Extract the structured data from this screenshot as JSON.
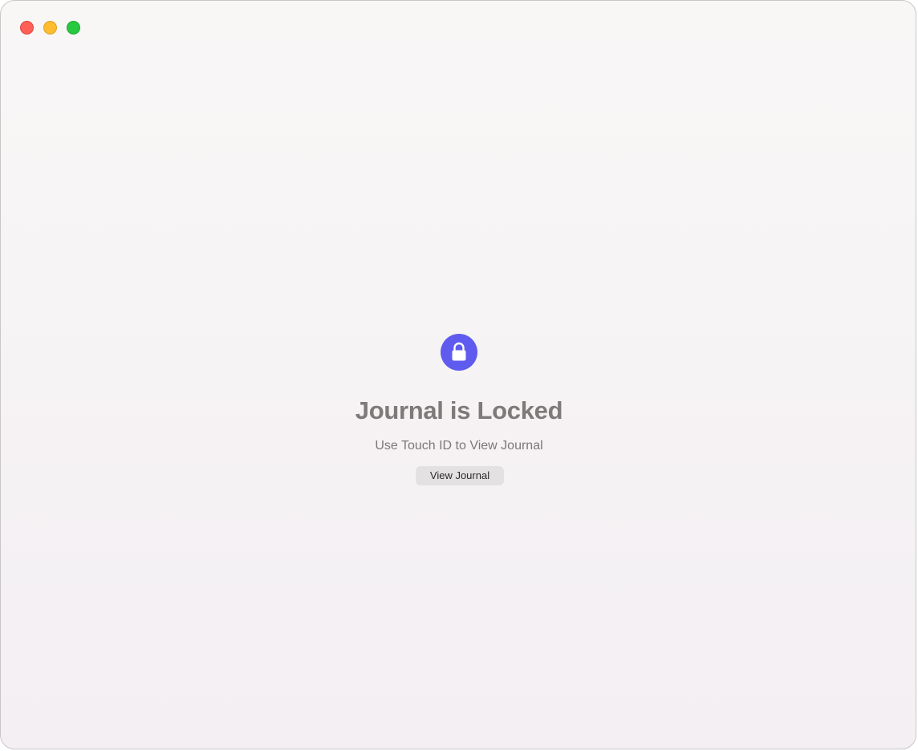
{
  "window": {
    "controls": {
      "close_color": "#fe5f57",
      "minimize_color": "#febc2e",
      "zoom_color": "#28c840"
    }
  },
  "locked_screen": {
    "icon": "lock-icon",
    "icon_color": "#5f5bef",
    "title": "Journal is Locked",
    "subtitle": "Use Touch ID to View Journal",
    "button_label": "View Journal"
  }
}
